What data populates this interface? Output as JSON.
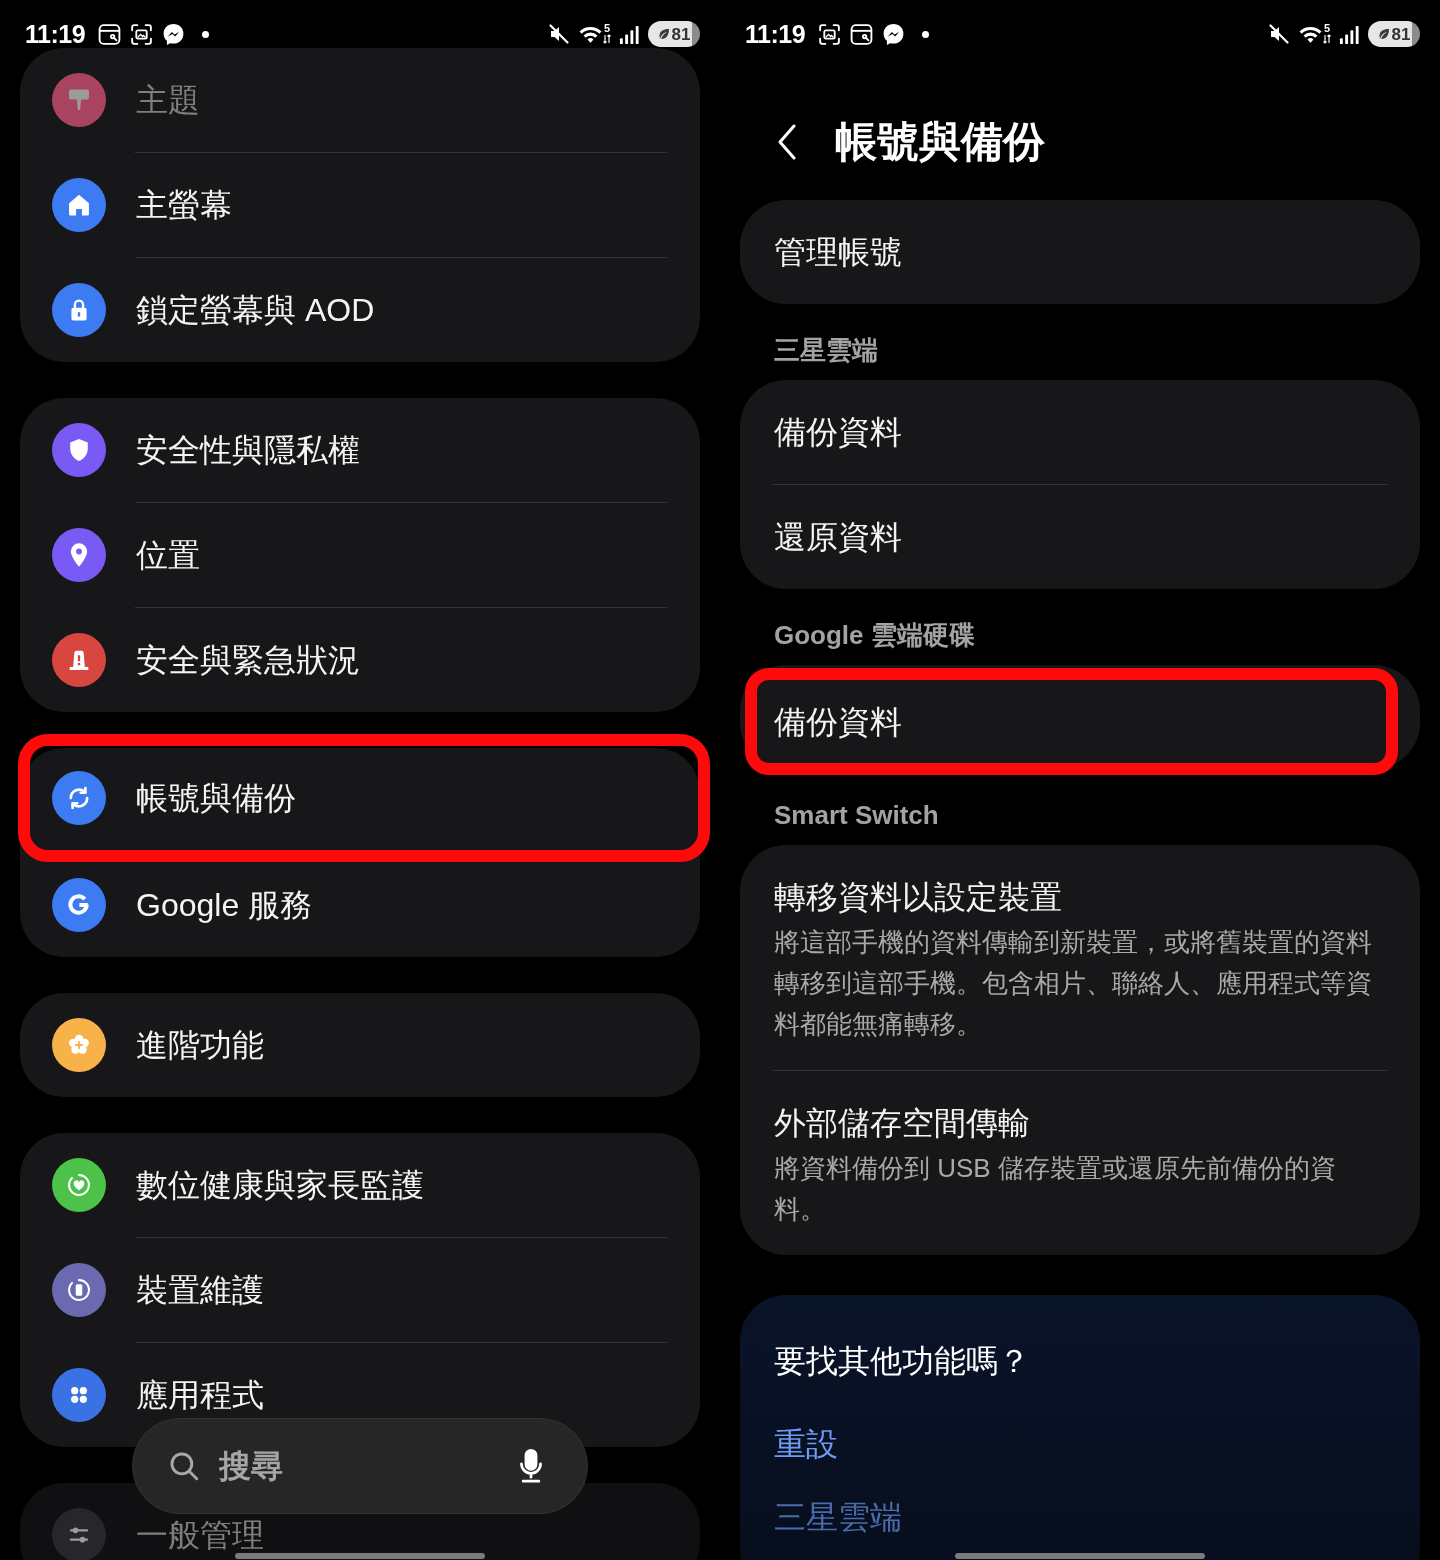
{
  "left_screen": {
    "status_bar": {
      "time": "11:19",
      "wifi_band": "5",
      "battery": "81"
    },
    "groups": [
      {
        "items": [
          {
            "label": "主題",
            "color": "#a8445f",
            "dimmed": true,
            "highlighted": false
          },
          {
            "label": "主螢幕",
            "color": "#3d7bf2",
            "dimmed": false,
            "highlighted": false
          },
          {
            "label": "鎖定螢幕與 AOD",
            "color": "#3d7bf2",
            "dimmed": false,
            "highlighted": false
          }
        ]
      },
      {
        "items": [
          {
            "label": "安全性與隱私權",
            "color": "#7a5af5",
            "dimmed": false,
            "highlighted": false
          },
          {
            "label": "位置",
            "color": "#7a5af5",
            "dimmed": false,
            "highlighted": false
          },
          {
            "label": "安全與緊急狀況",
            "color": "#d8473f",
            "dimmed": false,
            "highlighted": false
          }
        ]
      },
      {
        "items": [
          {
            "label": "帳號與備份",
            "color": "#3d7bf2",
            "dimmed": false,
            "highlighted": true
          },
          {
            "label": "Google 服務",
            "color": "#3d7bf2",
            "dimmed": false,
            "highlighted": false
          }
        ]
      },
      {
        "items": [
          {
            "label": "進階功能",
            "color": "#f7b24a",
            "dimmed": false,
            "highlighted": false
          }
        ]
      },
      {
        "items": [
          {
            "label": "數位健康與家長監護",
            "color": "#4cc249",
            "dimmed": false,
            "highlighted": false
          },
          {
            "label": "裝置維護",
            "color": "#6b69b0",
            "dimmed": false,
            "highlighted": false
          },
          {
            "label": "應用程式",
            "color": "#3a72e6",
            "dimmed": false,
            "highlighted": false
          }
        ]
      },
      {
        "items": [
          {
            "label": "一般管理",
            "color": "#26262c",
            "dimmed": true,
            "highlighted": false
          }
        ]
      }
    ],
    "search": {
      "placeholder": "搜尋"
    }
  },
  "right_screen": {
    "status_bar": {
      "time": "11:19",
      "wifi_band": "5",
      "battery": "81"
    },
    "header": {
      "title": "帳號與備份"
    },
    "sections": [
      {
        "items": [
          {
            "title": "管理帳號",
            "highlighted": false
          }
        ]
      },
      {
        "heading": "三星雲端",
        "items": [
          {
            "title": "備份資料",
            "highlighted": false
          },
          {
            "title": "還原資料",
            "highlighted": false
          }
        ]
      },
      {
        "heading": "Google 雲端硬碟",
        "items": [
          {
            "title": "備份資料",
            "highlighted": true
          }
        ]
      },
      {
        "heading": "Smart Switch",
        "items": [
          {
            "title": "轉移資料以設定裝置",
            "description": "將這部手機的資料傳輸到新裝置，或將舊裝置的資料轉移到這部手機。包含相片、聯絡人、應用程式等資料都能無痛轉移。",
            "highlighted": false
          },
          {
            "title": "外部儲存空間傳輸",
            "description": "將資料備份到 USB 儲存裝置或還原先前備份的資料。",
            "highlighted": false
          }
        ]
      }
    ],
    "suggestions": {
      "title": "要找其他功能嗎？",
      "links": [
        {
          "label": "重設",
          "dimmed": false
        },
        {
          "label": "三星雲端",
          "dimmed": true
        }
      ]
    }
  }
}
